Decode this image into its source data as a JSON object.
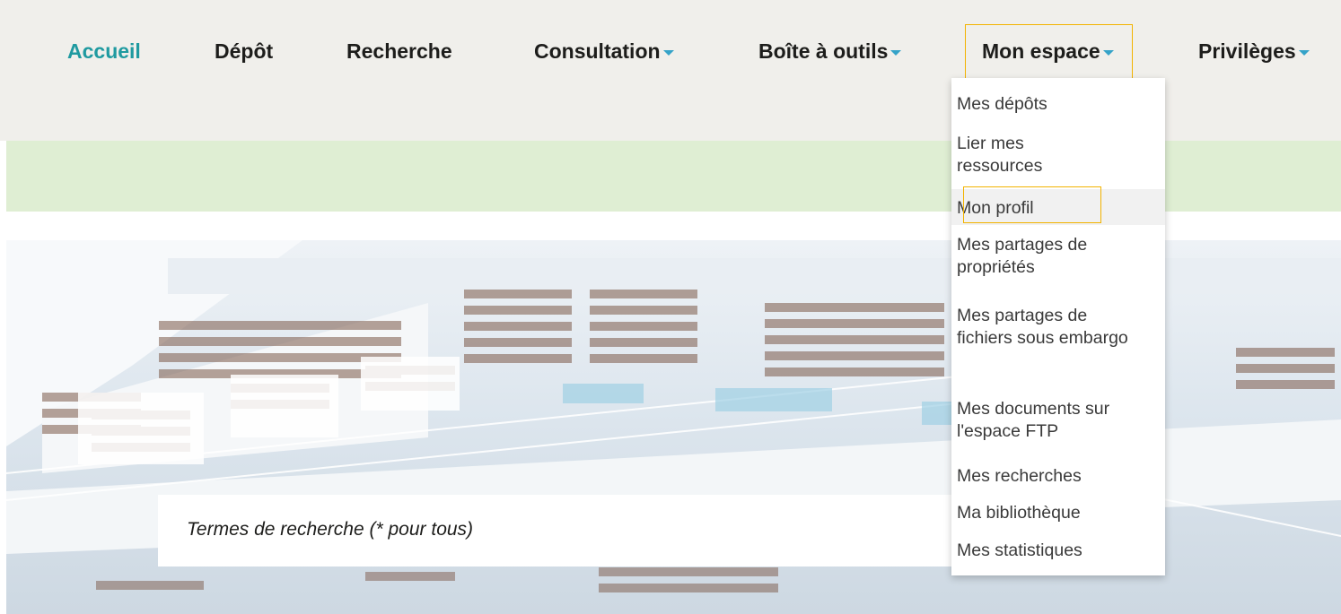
{
  "nav": {
    "items": [
      {
        "label": "Accueil",
        "active": true,
        "has_caret": false
      },
      {
        "label": "Dépôt",
        "has_caret": false
      },
      {
        "label": "Recherche",
        "has_caret": false
      },
      {
        "label": "Consultation",
        "has_caret": true
      },
      {
        "label": "Boîte à outils",
        "has_caret": true
      },
      {
        "label": "Mon espace",
        "has_caret": true,
        "highlighted": true
      },
      {
        "label": "Privilèges",
        "has_caret": true
      }
    ]
  },
  "dropdown": {
    "items": [
      {
        "label": "Mes dépôts"
      },
      {
        "label": "Lier mes ressources"
      },
      {
        "label": "Mon profil",
        "selected": true
      },
      {
        "label": "Mes partages de propriétés"
      },
      {
        "label": "Mes partages de fichiers sous embargo"
      },
      {
        "label": "Mes documents sur l'espace FTP"
      },
      {
        "label": "Mes recherches"
      },
      {
        "label": "Ma bibliothèque"
      },
      {
        "label": "Mes statistiques"
      }
    ]
  },
  "search": {
    "placeholder": "Termes de recherche (* pour tous)"
  },
  "colors": {
    "active_nav": "#1f9aa0",
    "caret": "#35a3c8",
    "highlight_border": "#f2b300",
    "top_band": "#f0efeb",
    "green_band": "#dfeed3"
  }
}
